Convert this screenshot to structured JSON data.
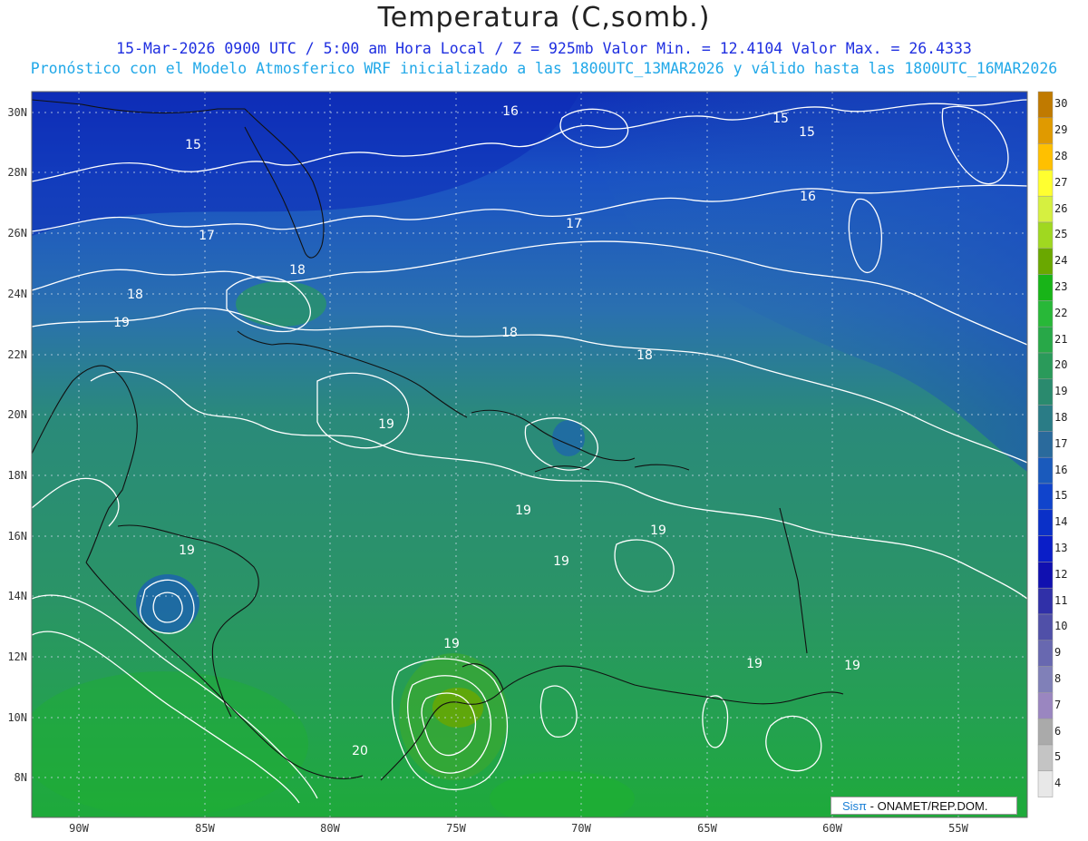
{
  "header": {
    "title": "Temperatura (C,somb.)",
    "line1": "15-Mar-2026  0900 UTC / 5:00 am Hora Local / Z = 925mb    Valor Min. = 12.4104  Valor Max. = 26.4333",
    "line2": "Pronóstico con el Modelo Atmosferico WRF inicializado a las 1800UTC_13MAR2026 y válido hasta las  1800UTC_16MAR2026"
  },
  "axes": {
    "lat_labels": [
      "30N",
      "28N",
      "26N",
      "24N",
      "22N",
      "20N",
      "18N",
      "16N",
      "14N",
      "12N",
      "10N",
      "8N"
    ],
    "lon_labels": [
      "90W",
      "85W",
      "80W",
      "75W",
      "70W",
      "65W",
      "60W",
      "55W"
    ]
  },
  "colorbar": {
    "labels": [
      "30",
      "29",
      "28",
      "27",
      "26",
      "25",
      "24",
      "23",
      "22",
      "21",
      "20",
      "19",
      "18",
      "17",
      "16",
      "15",
      "14",
      "13",
      "12",
      "11",
      "10",
      "9",
      "8",
      "7",
      "6",
      "5",
      "4"
    ],
    "colors": [
      "#c07a00",
      "#e09a00",
      "#ffc000",
      "#ffff30",
      "#d6f040",
      "#a0d820",
      "#6aa800",
      "#18b418",
      "#28b838",
      "#28a848",
      "#2a9a5a",
      "#2a8a6e",
      "#2a7c86",
      "#2a6a9c",
      "#1a5abc",
      "#1044cc",
      "#0a30c8",
      "#0a1ec8",
      "#1010b0",
      "#3030a8",
      "#5050a8",
      "#6868b0",
      "#8080b8",
      "#9a86c0",
      "#aaaaaa",
      "#c4c4c4",
      "#e8e8e8"
    ]
  },
  "contour_labels": [
    {
      "text": "16"
    },
    {
      "text": "15"
    },
    {
      "text": "15"
    },
    {
      "text": "15"
    },
    {
      "text": "16"
    },
    {
      "text": "17"
    },
    {
      "text": "17"
    },
    {
      "text": "18"
    },
    {
      "text": "18"
    },
    {
      "text": "19"
    },
    {
      "text": "18"
    },
    {
      "text": "18"
    },
    {
      "text": "19"
    },
    {
      "text": "19"
    },
    {
      "text": "19"
    },
    {
      "text": "19"
    },
    {
      "text": "19"
    },
    {
      "text": "19"
    },
    {
      "text": "19"
    },
    {
      "text": "19"
    },
    {
      "text": "20"
    }
  ],
  "footer": {
    "sis": "Sisπ",
    "org": "- ONAMET/REP.DOM."
  }
}
